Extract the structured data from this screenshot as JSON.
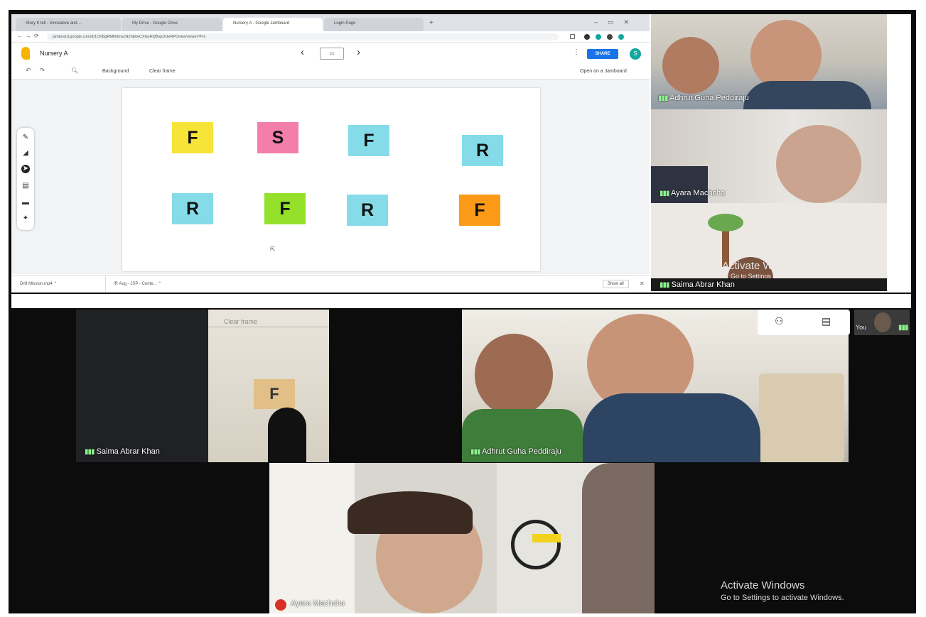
{
  "browser": {
    "tabs": [
      {
        "label": "Story It tell - Innovative and ..."
      },
      {
        "label": "My Drive - Google Drive"
      },
      {
        "label": "Nursery A - Google Jamboard"
      },
      {
        "label": "Login Page"
      }
    ],
    "new_tab_label": "+",
    "url": "jamboard.google.com/d/1CKBgRMhNrrwcNZh8neCXGyHQBspUUeRPOnkw/viewer?f=2"
  },
  "jamboard": {
    "title": "Nursery A",
    "frame_prev": "‹",
    "frame_next": "›",
    "frame_counter": "1/1",
    "share_label": "SHARE",
    "avatar_letter": "S",
    "toolbar": {
      "background_label": "Background",
      "clear_frame_label": "Clear frame",
      "open_on_jamboard_label": "Open on a Jamboard"
    },
    "notes": [
      {
        "letter": "F",
        "color": "#f7e438"
      },
      {
        "letter": "S",
        "color": "#f27ea9"
      },
      {
        "letter": "F",
        "color": "#85dce8"
      },
      {
        "letter": "R",
        "color": "#85dce8"
      },
      {
        "letter": "R",
        "color": "#85dce8"
      },
      {
        "letter": "F",
        "color": "#94e02b"
      },
      {
        "letter": "R",
        "color": "#85dce8"
      },
      {
        "letter": "F",
        "color": "#fb9a17"
      }
    ]
  },
  "downloads": {
    "items": [
      {
        "label": "Drill Mission.mp4"
      },
      {
        "label": "IR Aug - JSP - Conte..."
      }
    ],
    "show_all_label": "Show all"
  },
  "meet_top": {
    "participants": [
      {
        "name": "Adhrut Guha Peddiraju"
      },
      {
        "name": "Ayara Machcha"
      },
      {
        "name": "Saima Abrar Khan"
      }
    ],
    "watermark": "Activate W",
    "watermark_sub": "Go to Settings"
  },
  "meet_main": {
    "shared_screen_text": "Clear frame",
    "shared_note_letter": "F",
    "tiles": [
      {
        "name": "Saima Abrar Khan"
      },
      {
        "name": "Adhrut Guha Peddiraju"
      },
      {
        "name": "Ayara Machcha"
      }
    ],
    "self_label": "You",
    "watermark_title": "Activate Windows",
    "watermark_sub": "Go to Settings to activate Windows."
  },
  "colors": {
    "accent": "#1a73e8",
    "teal": "#12a89d",
    "dots_green": "#8ef08e",
    "mic_off_red": "#d93025"
  }
}
